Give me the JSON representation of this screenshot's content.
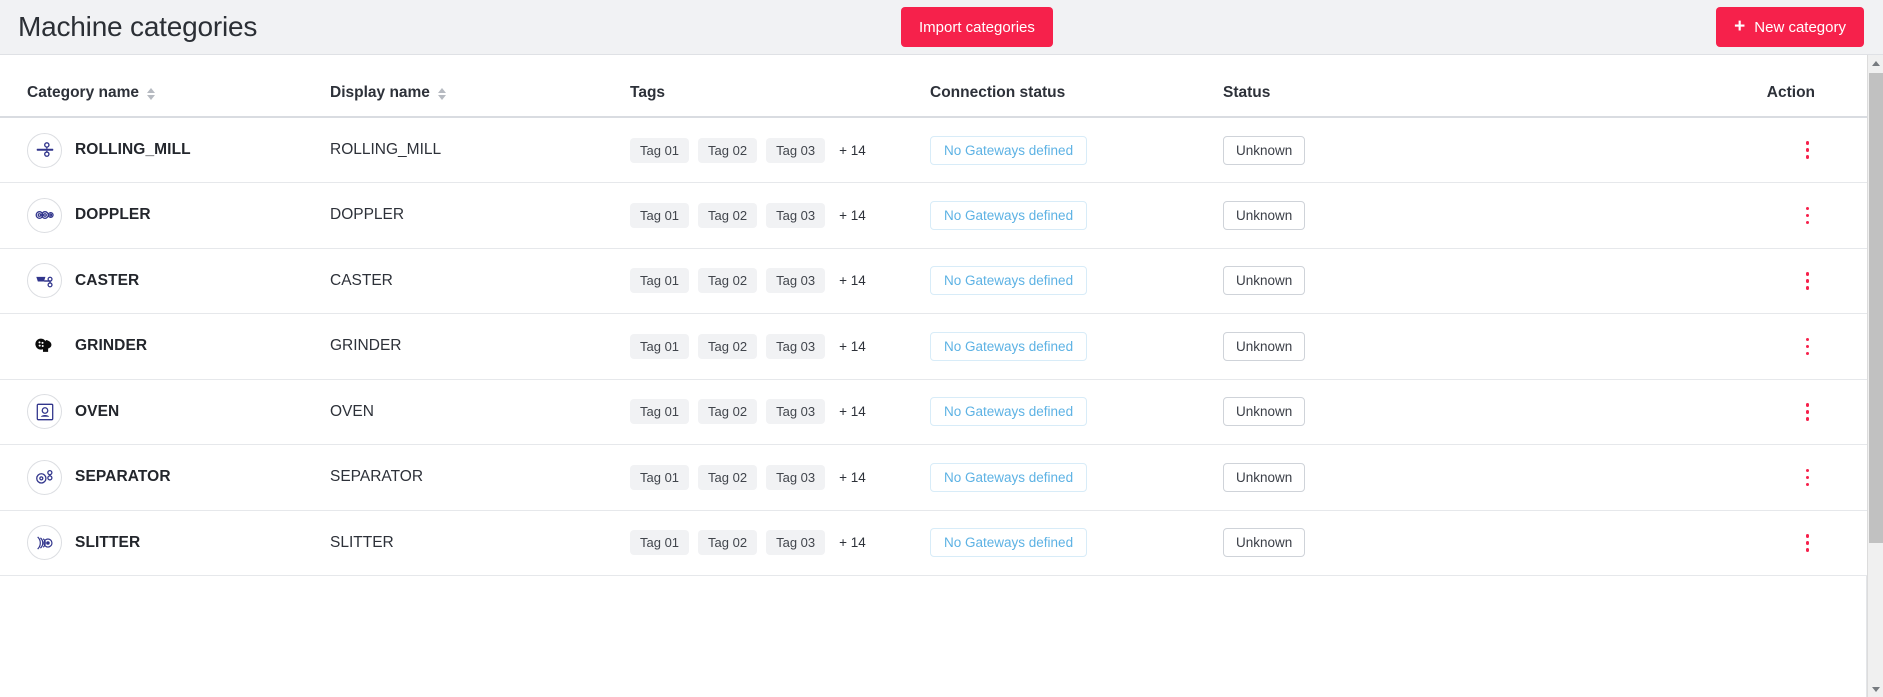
{
  "header": {
    "title": "Machine categories",
    "import_button": "Import categories",
    "new_button": "New category",
    "new_button_icon": "plus-icon",
    "accent_color": "#f6214b"
  },
  "table": {
    "columns": [
      {
        "key": "category_name",
        "label": "Category name",
        "sortable": true
      },
      {
        "key": "display_name",
        "label": "Display name",
        "sortable": true
      },
      {
        "key": "tags",
        "label": "Tags",
        "sortable": false
      },
      {
        "key": "connection_status",
        "label": "Connection status",
        "sortable": false
      },
      {
        "key": "status",
        "label": "Status",
        "sortable": false
      },
      {
        "key": "action",
        "label": "Action",
        "sortable": false
      }
    ],
    "rows": [
      {
        "icon": "rolling-mill-icon",
        "category_name": "ROLLING_MILL",
        "display_name": "ROLLING_MILL",
        "tags": [
          "Tag 01",
          "Tag 02",
          "Tag 03"
        ],
        "tags_more": "+ 14",
        "connection_status": "No Gateways defined",
        "status": "Unknown",
        "action_icon": "kebab-menu-icon"
      },
      {
        "icon": "doppler-icon",
        "category_name": "DOPPLER",
        "display_name": "DOPPLER",
        "tags": [
          "Tag 01",
          "Tag 02",
          "Tag 03"
        ],
        "tags_more": "+ 14",
        "connection_status": "No Gateways defined",
        "status": "Unknown",
        "action_icon": "kebab-menu-icon"
      },
      {
        "icon": "caster-icon",
        "category_name": "CASTER",
        "display_name": "CASTER",
        "tags": [
          "Tag 01",
          "Tag 02",
          "Tag 03"
        ],
        "tags_more": "+ 14",
        "connection_status": "No Gateways defined",
        "status": "Unknown",
        "action_icon": "kebab-menu-icon"
      },
      {
        "icon": "grinder-icon",
        "category_name": "GRINDER",
        "display_name": "GRINDER",
        "tags": [
          "Tag 01",
          "Tag 02",
          "Tag 03"
        ],
        "tags_more": "+ 14",
        "connection_status": "No Gateways defined",
        "status": "Unknown",
        "action_icon": "kebab-menu-icon"
      },
      {
        "icon": "oven-icon",
        "category_name": "OVEN",
        "display_name": "OVEN",
        "tags": [
          "Tag 01",
          "Tag 02",
          "Tag 03"
        ],
        "tags_more": "+ 14",
        "connection_status": "No Gateways defined",
        "status": "Unknown",
        "action_icon": "kebab-menu-icon"
      },
      {
        "icon": "separator-icon",
        "category_name": "SEPARATOR",
        "display_name": "SEPARATOR",
        "tags": [
          "Tag 01",
          "Tag 02",
          "Tag 03"
        ],
        "tags_more": "+ 14",
        "connection_status": "No Gateways defined",
        "status": "Unknown",
        "action_icon": "kebab-menu-icon"
      },
      {
        "icon": "slitter-icon",
        "category_name": "SLITTER",
        "display_name": "SLITTER",
        "tags": [
          "Tag 01",
          "Tag 02",
          "Tag 03"
        ],
        "tags_more": "+ 14",
        "connection_status": "No Gateways defined",
        "status": "Unknown",
        "action_icon": "kebab-menu-icon"
      }
    ]
  }
}
